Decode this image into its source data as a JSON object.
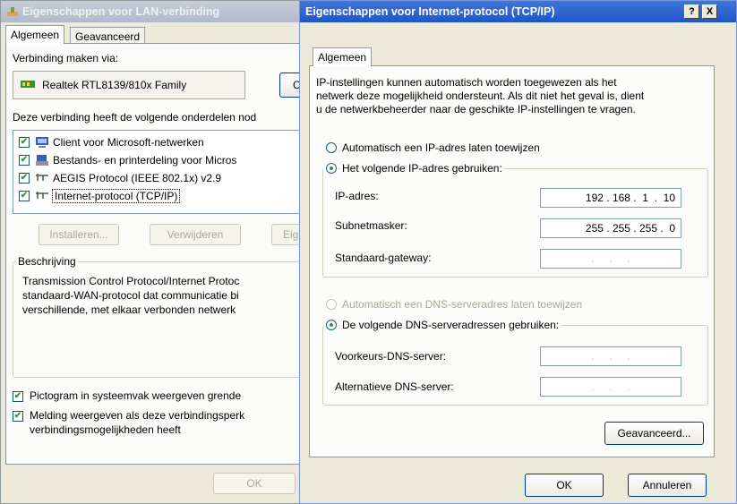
{
  "back_window": {
    "title": "Eigenschappen voor LAN-verbinding",
    "tabs": [
      "Algemeen",
      "Geavanceerd"
    ],
    "connect_via_label": "Verbinding maken via:",
    "adapter_name": "Realtek RTL8139/810x Family",
    "configure_button": "C",
    "components_label": "Deze verbinding heeft de volgende onderdelen nod",
    "components": [
      {
        "label": "Client voor Microsoft-netwerken",
        "checked": true,
        "icon": "network-client-icon"
      },
      {
        "label": "Bestands- en printerdeling voor Micros",
        "checked": true,
        "icon": "file-printer-sharing-icon"
      },
      {
        "label": "AEGIS Protocol (IEEE 802.1x) v2.9",
        "checked": true,
        "icon": "protocol-icon"
      },
      {
        "label": "Internet-protocol (TCP/IP)",
        "checked": true,
        "icon": "protocol-icon",
        "selected": true
      }
    ],
    "install_button": "Installeren...",
    "uninstall_button": "Verwijderen",
    "properties_button": "Eig",
    "description_group": "Beschrijving",
    "description_lines": [
      "Transmission Control Protocol/Internet Protoc",
      "standaard-WAN-protocol dat communicatie bi",
      "verschillende, met elkaar verbonden netwerk"
    ],
    "show_icon_label": "Pictogram in systeemvak weergeven grende",
    "notify_label_1": "Melding weergeven als deze verbindingsperk",
    "notify_label_2": "verbindingsmogelijkheden heeft",
    "ok_button": "OK"
  },
  "front_window": {
    "title": "Eigenschappen voor Internet-protocol (TCP/IP)",
    "help_button": "?",
    "close_button": "X",
    "tab": "Algemeen",
    "intro_lines": [
      "IP-instellingen kunnen automatisch worden toegewezen als het",
      "netwerk deze mogelijkheid ondersteunt. Als dit niet het geval is, dient",
      "u de netwerkbeheerder naar de geschikte IP-instellingen te vragen."
    ],
    "auto_ip_label": "Automatisch een IP-adres laten toewijzen",
    "manual_ip_label": "Het volgende IP-adres gebruiken:",
    "ip_label": "IP-adres:",
    "ip_value": "192 . 168 .  1  .  10",
    "subnet_label": "Subnetmasker:",
    "subnet_value": "255 . 255 . 255 .  0",
    "gateway_label": "Standaard-gateway:",
    "gateway_value": ".     .     .",
    "auto_dns_label": "Automatisch een DNS-serveradres laten toewijzen",
    "manual_dns_label": "De volgende DNS-serveradressen gebruiken:",
    "preferred_dns_label": "Voorkeurs-DNS-server:",
    "preferred_dns_value": ".     .     .",
    "alternate_dns_label": "Alternatieve DNS-server:",
    "alternate_dns_value": ".     .     .",
    "advanced_button": "Geavanceerd...",
    "ok_button": "OK",
    "cancel_button": "Annuleren"
  }
}
